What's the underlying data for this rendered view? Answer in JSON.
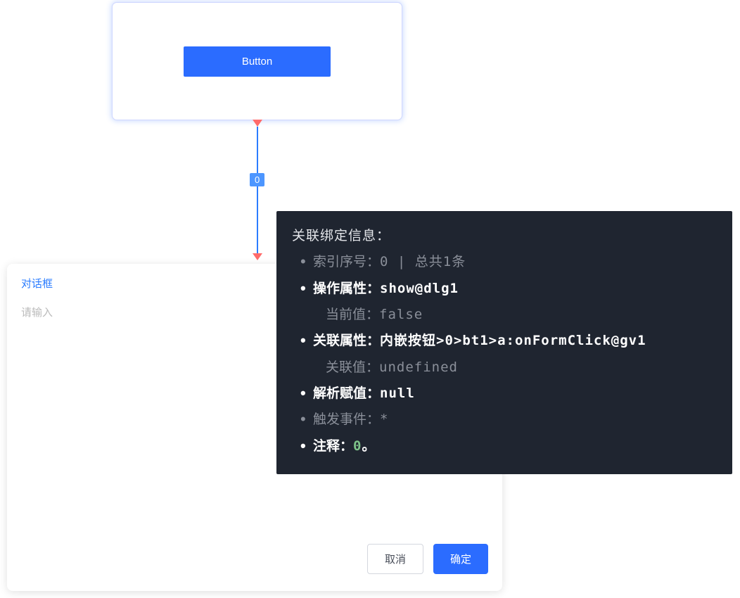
{
  "top_node": {
    "button_label": "Button"
  },
  "connector": {
    "label": "0"
  },
  "dialog": {
    "title": "对话框",
    "placeholder": "请输入",
    "cancel": "取消",
    "ok": "确定"
  },
  "info": {
    "title": "关联绑定信息：",
    "index_label": "索引序号：",
    "index_value": "0 | 总共1条",
    "op_label": "操作属性：",
    "op_value": "show@dlg1",
    "cur_label": "当前值：",
    "cur_value": "false",
    "rel_label": "关联属性：",
    "rel_value": "内嵌按钮>0>bt1>a:onFormClick@gv1",
    "relval_label": "关联值：",
    "relval_value": "undefined",
    "parse_label": "解析赋值：",
    "parse_value": "null",
    "trigger_label": "触发事件：",
    "trigger_value": "*",
    "note_label": "注释：",
    "note_value": "0",
    "note_suffix": "。"
  }
}
